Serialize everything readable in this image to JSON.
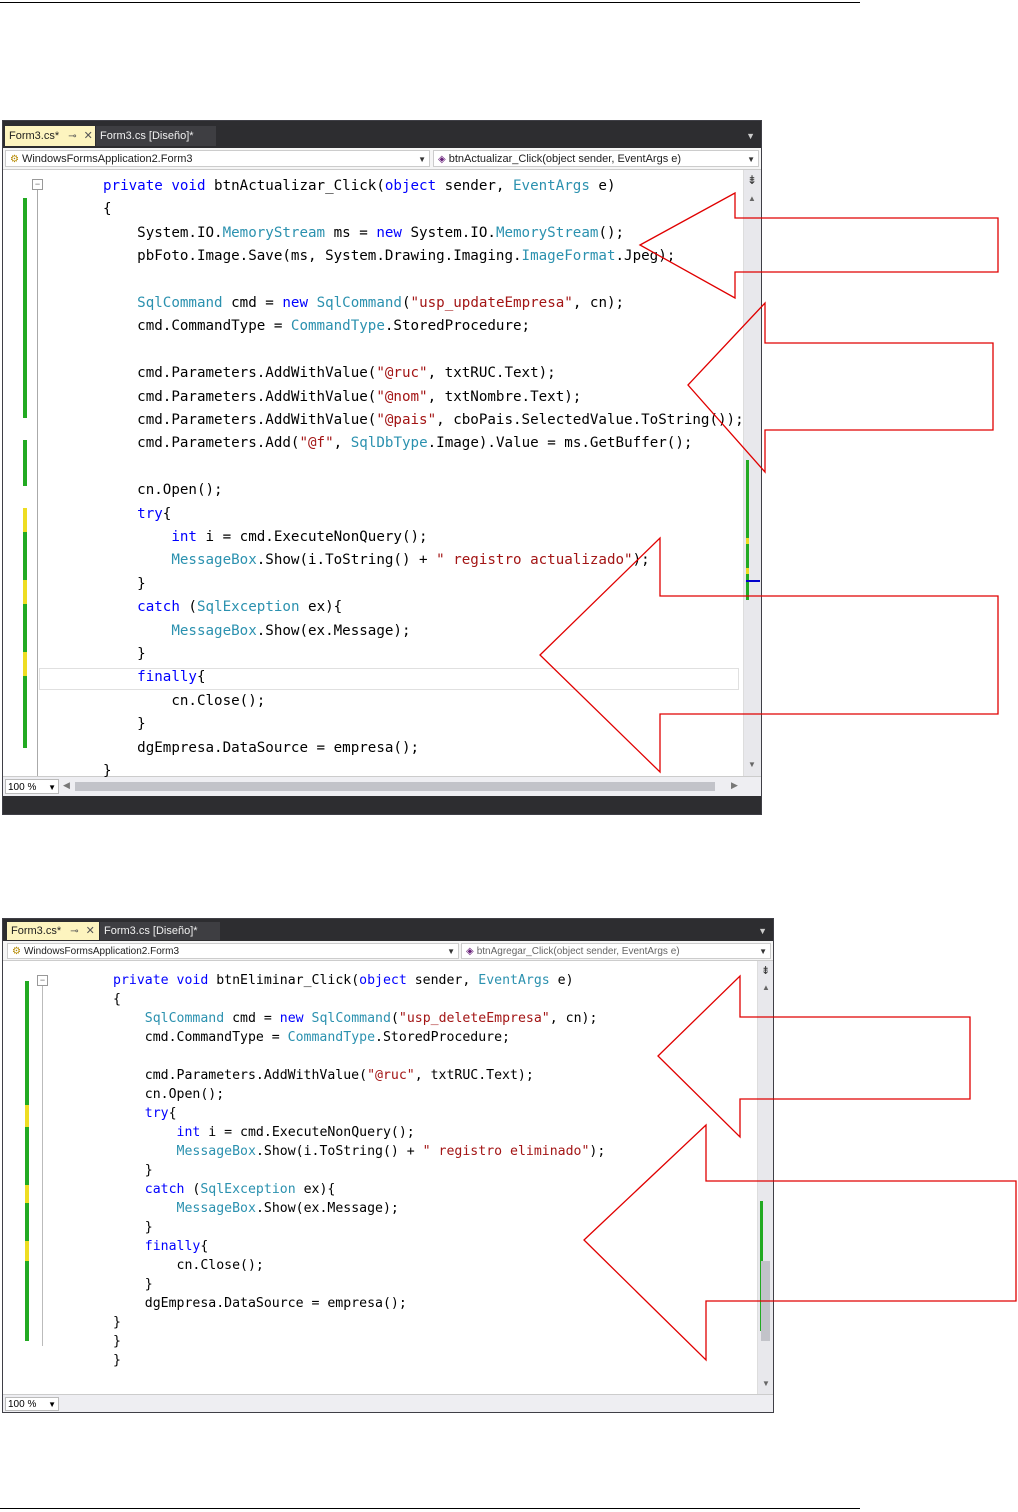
{
  "screens": [
    {
      "tabs": [
        {
          "label": "Form3.cs*"
        },
        {
          "label": "Form3.cs [Diseño]*"
        }
      ],
      "nav_left": "WindowsFormsApplication2.Form3",
      "nav_right": "btnActualizar_Click(object sender, EventArgs e)",
      "zoom": "100 %",
      "code": [
        [
          [
            "k",
            "private"
          ],
          [
            "p",
            " "
          ],
          [
            "k",
            "void"
          ],
          [
            "p",
            " btnActualizar_Click("
          ],
          [
            "k",
            "object"
          ],
          [
            "p",
            " sender, "
          ],
          [
            "t",
            "EventArgs"
          ],
          [
            "p",
            " e)"
          ]
        ],
        [
          [
            "p",
            "{"
          ]
        ],
        [
          [
            "p",
            "    System.IO."
          ],
          [
            "t",
            "MemoryStream"
          ],
          [
            "p",
            " ms = "
          ],
          [
            "k",
            "new"
          ],
          [
            "p",
            " System.IO."
          ],
          [
            "t",
            "MemoryStream"
          ],
          [
            "p",
            "();"
          ]
        ],
        [
          [
            "p",
            "    pbFoto.Image.Save(ms, System.Drawing.Imaging."
          ],
          [
            "t",
            "ImageFormat"
          ],
          [
            "p",
            ".Jpeg);"
          ]
        ],
        [],
        [
          [
            "p",
            "    "
          ],
          [
            "t",
            "SqlCommand"
          ],
          [
            "p",
            " cmd = "
          ],
          [
            "k",
            "new"
          ],
          [
            "p",
            " "
          ],
          [
            "t",
            "SqlCommand"
          ],
          [
            "p",
            "("
          ],
          [
            "s",
            "\"usp_updateEmpresa\""
          ],
          [
            "p",
            ", cn);"
          ]
        ],
        [
          [
            "p",
            "    cmd.CommandType = "
          ],
          [
            "t",
            "CommandType"
          ],
          [
            "p",
            ".StoredProcedure;"
          ]
        ],
        [],
        [
          [
            "p",
            "    cmd.Parameters.AddWithValue("
          ],
          [
            "s",
            "\"@ruc\""
          ],
          [
            "p",
            ", txtRUC.Text);"
          ]
        ],
        [
          [
            "p",
            "    cmd.Parameters.AddWithValue("
          ],
          [
            "s",
            "\"@nom\""
          ],
          [
            "p",
            ", txtNombre.Text);"
          ]
        ],
        [
          [
            "p",
            "    cmd.Parameters.AddWithValue("
          ],
          [
            "s",
            "\"@pais\""
          ],
          [
            "p",
            ", cboPais.SelectedValue.ToString());"
          ]
        ],
        [
          [
            "p",
            "    cmd.Parameters.Add("
          ],
          [
            "s",
            "\"@f\""
          ],
          [
            "p",
            ", "
          ],
          [
            "t",
            "SqlDbType"
          ],
          [
            "p",
            ".Image).Value = ms.GetBuffer();"
          ]
        ],
        [],
        [
          [
            "p",
            "    cn.Open();"
          ]
        ],
        [
          [
            "p",
            "    "
          ],
          [
            "k",
            "try"
          ],
          [
            "p",
            "{"
          ]
        ],
        [
          [
            "p",
            "        "
          ],
          [
            "k",
            "int"
          ],
          [
            "p",
            " i = cmd.ExecuteNonQuery();"
          ]
        ],
        [
          [
            "p",
            "        "
          ],
          [
            "t",
            "MessageBox"
          ],
          [
            "p",
            ".Show(i.ToString() + "
          ],
          [
            "s",
            "\" registro actualizado\""
          ],
          [
            "p",
            ");"
          ]
        ],
        [
          [
            "p",
            "    }"
          ]
        ],
        [
          [
            "p",
            "    "
          ],
          [
            "k",
            "catch"
          ],
          [
            "p",
            " ("
          ],
          [
            "t",
            "SqlException"
          ],
          [
            "p",
            " ex){"
          ]
        ],
        [
          [
            "p",
            "        "
          ],
          [
            "t",
            "MessageBox"
          ],
          [
            "p",
            ".Show(ex.Message);"
          ]
        ],
        [
          [
            "p",
            "    }"
          ]
        ],
        [
          [
            "p",
            "    "
          ],
          [
            "k",
            "finally"
          ],
          [
            "p",
            "{"
          ]
        ],
        [
          [
            "p",
            "        cn.Close();"
          ]
        ],
        [
          [
            "p",
            "    }"
          ]
        ],
        [
          [
            "p",
            "    dgEmpresa.DataSource = empresa();"
          ]
        ],
        [
          [
            "p",
            "}"
          ]
        ]
      ]
    },
    {
      "tabs": [
        {
          "label": "Form3.cs*"
        },
        {
          "label": "Form3.cs [Diseño]*"
        }
      ],
      "nav_left": "WindowsFormsApplication2.Form3",
      "nav_right": "btnAgregar_Click(object sender, EventArgs e)",
      "zoom": "100 %",
      "code": [
        [
          [
            "k",
            "private"
          ],
          [
            "p",
            " "
          ],
          [
            "k",
            "void"
          ],
          [
            "p",
            " btnEliminar_Click("
          ],
          [
            "k",
            "object"
          ],
          [
            "p",
            " sender, "
          ],
          [
            "t",
            "EventArgs"
          ],
          [
            "p",
            " e)"
          ]
        ],
        [
          [
            "p",
            "{"
          ]
        ],
        [
          [
            "p",
            "    "
          ],
          [
            "t",
            "SqlCommand"
          ],
          [
            "p",
            " cmd = "
          ],
          [
            "k",
            "new"
          ],
          [
            "p",
            " "
          ],
          [
            "t",
            "SqlCommand"
          ],
          [
            "p",
            "("
          ],
          [
            "s",
            "\"usp_deleteEmpresa\""
          ],
          [
            "p",
            ", cn);"
          ]
        ],
        [
          [
            "p",
            "    cmd.CommandType = "
          ],
          [
            "t",
            "CommandType"
          ],
          [
            "p",
            ".StoredProcedure;"
          ]
        ],
        [],
        [
          [
            "p",
            "    cmd.Parameters.AddWithValue("
          ],
          [
            "s",
            "\"@ruc\""
          ],
          [
            "p",
            ", txtRUC.Text);"
          ]
        ],
        [
          [
            "p",
            "    cn.Open();"
          ]
        ],
        [
          [
            "p",
            "    "
          ],
          [
            "k",
            "try"
          ],
          [
            "p",
            "{"
          ]
        ],
        [
          [
            "p",
            "        "
          ],
          [
            "k",
            "int"
          ],
          [
            "p",
            " i = cmd.ExecuteNonQuery();"
          ]
        ],
        [
          [
            "p",
            "        "
          ],
          [
            "t",
            "MessageBox"
          ],
          [
            "p",
            ".Show(i.ToString() + "
          ],
          [
            "s",
            "\" registro eliminado\""
          ],
          [
            "p",
            ");"
          ]
        ],
        [
          [
            "p",
            "    }"
          ]
        ],
        [
          [
            "p",
            "    "
          ],
          [
            "k",
            "catch"
          ],
          [
            "p",
            " ("
          ],
          [
            "t",
            "SqlException"
          ],
          [
            "p",
            " ex){"
          ]
        ],
        [
          [
            "p",
            "        "
          ],
          [
            "t",
            "MessageBox"
          ],
          [
            "p",
            ".Show(ex.Message);"
          ]
        ],
        [
          [
            "p",
            "    }"
          ]
        ],
        [
          [
            "p",
            "    "
          ],
          [
            "k",
            "finally"
          ],
          [
            "p",
            "{"
          ]
        ],
        [
          [
            "p",
            "        cn.Close();"
          ]
        ],
        [
          [
            "p",
            "    }"
          ]
        ],
        [
          [
            "p",
            "    dgEmpresa.DataSource = empresa();"
          ]
        ],
        [
          [
            "p",
            "}"
          ]
        ],
        [
          [
            "p",
            "}"
          ]
        ],
        [
          [
            "p",
            "}"
          ]
        ]
      ]
    }
  ],
  "colors": {
    "keyword": "#0000ff",
    "type": "#2b91af",
    "string": "#a31515",
    "change_saved": "#22aa22",
    "change_unsaved": "#eedd22",
    "arrow_outline": "#e00000"
  }
}
